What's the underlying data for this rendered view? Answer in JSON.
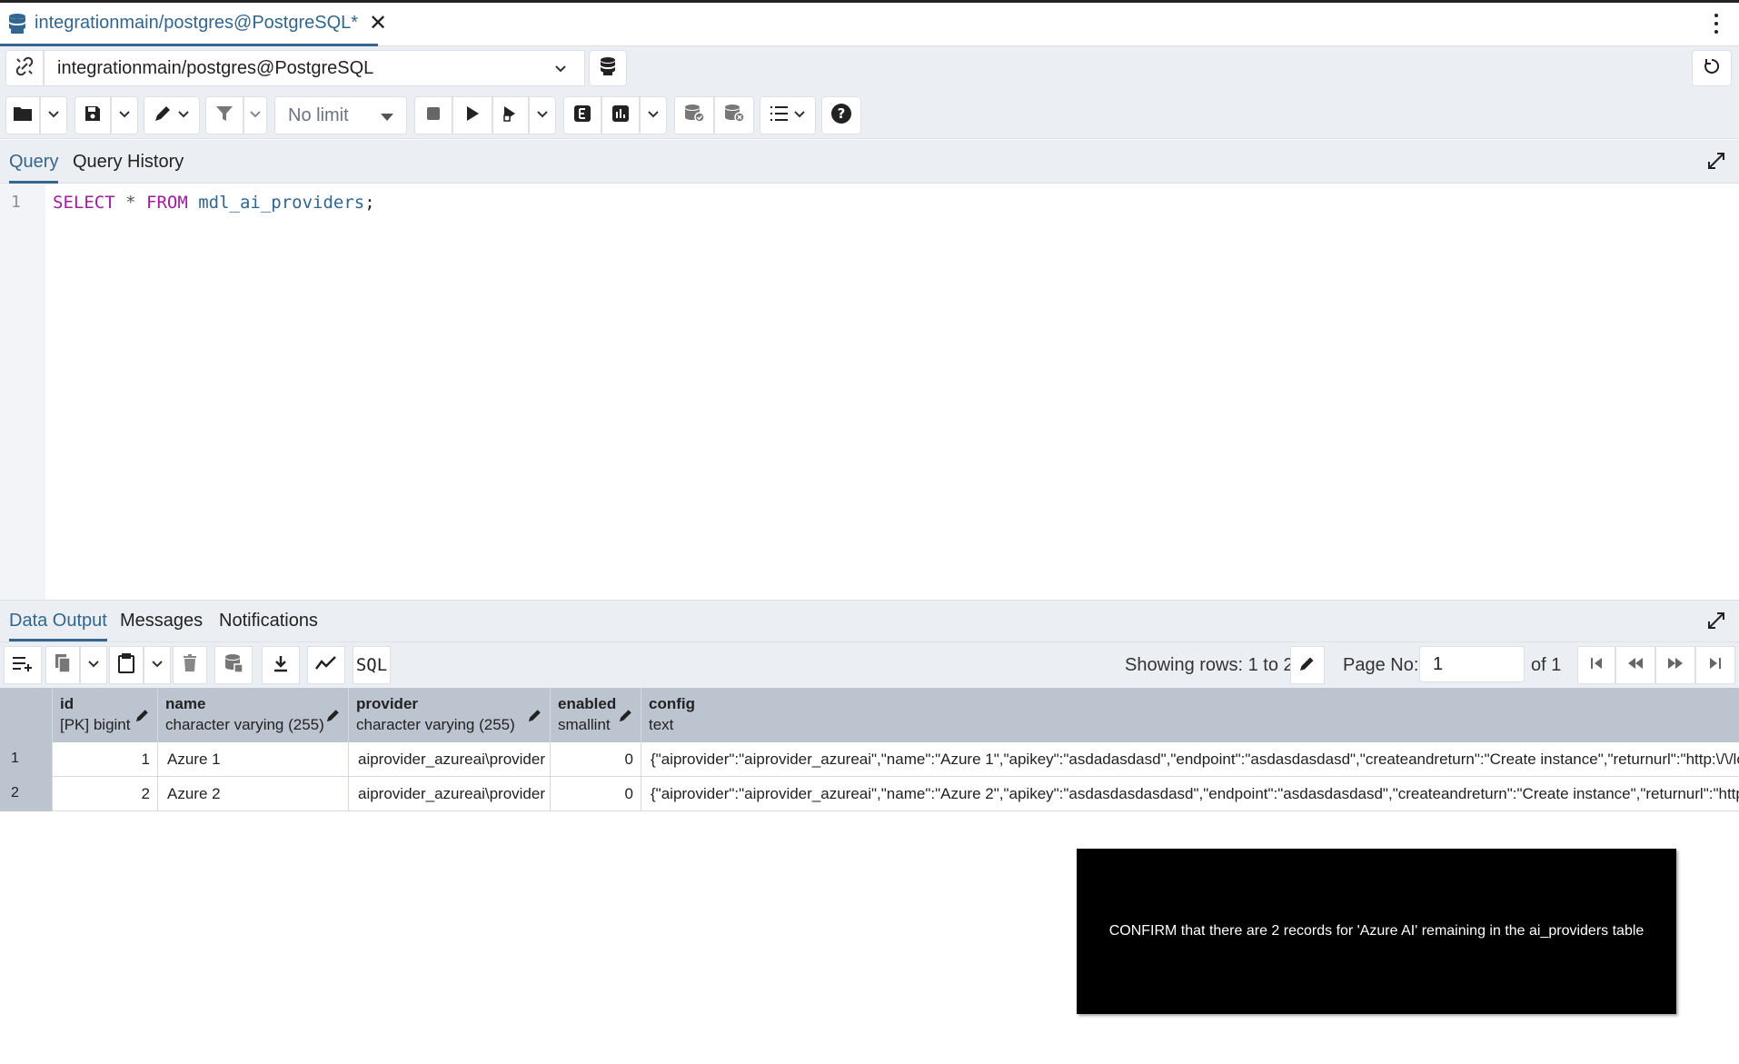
{
  "tab": {
    "title": "integrationmain/postgres@PostgreSQL*"
  },
  "connection": {
    "selected": "integrationmain/postgres@PostgreSQL"
  },
  "toolbar": {
    "limit_value": "No limit"
  },
  "editor_tabs": {
    "query": "Query",
    "history": "Query History"
  },
  "editor": {
    "line_number": "1",
    "tokens": {
      "select": "SELECT",
      "star": "*",
      "from": "FROM",
      "table": "mdl_ai_providers",
      "semicolon": ";"
    }
  },
  "result_tabs": {
    "data_output": "Data Output",
    "messages": "Messages",
    "notifications": "Notifications"
  },
  "results_toolbar": {
    "sql_label": "SQL",
    "rows_info": "Showing rows: 1 to 2",
    "page_label": "Page No:",
    "page_value": "1",
    "page_of": "of 1"
  },
  "grid": {
    "columns": [
      {
        "name": "id",
        "type": "[PK] bigint"
      },
      {
        "name": "name",
        "type": "character varying (255)"
      },
      {
        "name": "provider",
        "type": "character varying (255)"
      },
      {
        "name": "enabled",
        "type": "smallint"
      },
      {
        "name": "config",
        "type": "text"
      }
    ],
    "rows": [
      {
        "num": "1",
        "id": "1",
        "name": "Azure 1",
        "provider": "aiprovider_azureai\\provider",
        "enabled": "0",
        "config": "{\"aiprovider\":\"aiprovider_azureai\",\"name\":\"Azure 1\",\"apikey\":\"asdadasdasd\",\"endpoint\":\"asdasdasdasd\",\"createandreturn\":\"Create instance\",\"returnurl\":\"http:\\/\\/localhost\\/"
      },
      {
        "num": "2",
        "id": "2",
        "name": "Azure 2",
        "provider": "aiprovider_azureai\\provider",
        "enabled": "0",
        "config": "{\"aiprovider\":\"aiprovider_azureai\",\"name\":\"Azure 2\",\"apikey\":\"asdasdasdasdasd\",\"endpoint\":\"asdasdasdasd\",\"createandreturn\":\"Create instance\",\"returnurl\":\"http:\\/\\/localhost\\/"
      }
    ]
  },
  "overlay": {
    "text": "CONFIRM that there are 2 records for 'Azure AI' remaining in the ai_providers table"
  },
  "colors": {
    "accent": "#326690",
    "keyword": "#a01ca0",
    "toolbar_bg": "#ebeef3",
    "grid_header_bg": "#bcc4d0"
  },
  "icons": [
    "database-icon",
    "close-icon",
    "kebab-menu-icon",
    "link-icon",
    "chevron-down-icon",
    "reset-icon",
    "folder-icon",
    "save-icon",
    "edit-icon",
    "filter-icon",
    "stop-icon",
    "play-icon",
    "execute-script-icon",
    "explain-icon",
    "explain-analyze-icon",
    "commit-icon",
    "rollback-icon",
    "macros-icon",
    "help-icon",
    "expand-icon",
    "add-row-icon",
    "copy-icon",
    "paste-icon",
    "delete-icon",
    "save-data-icon",
    "download-icon",
    "graph-icon",
    "pencil-icon",
    "first-page-icon",
    "prev-page-icon",
    "next-page-icon",
    "last-page-icon"
  ]
}
